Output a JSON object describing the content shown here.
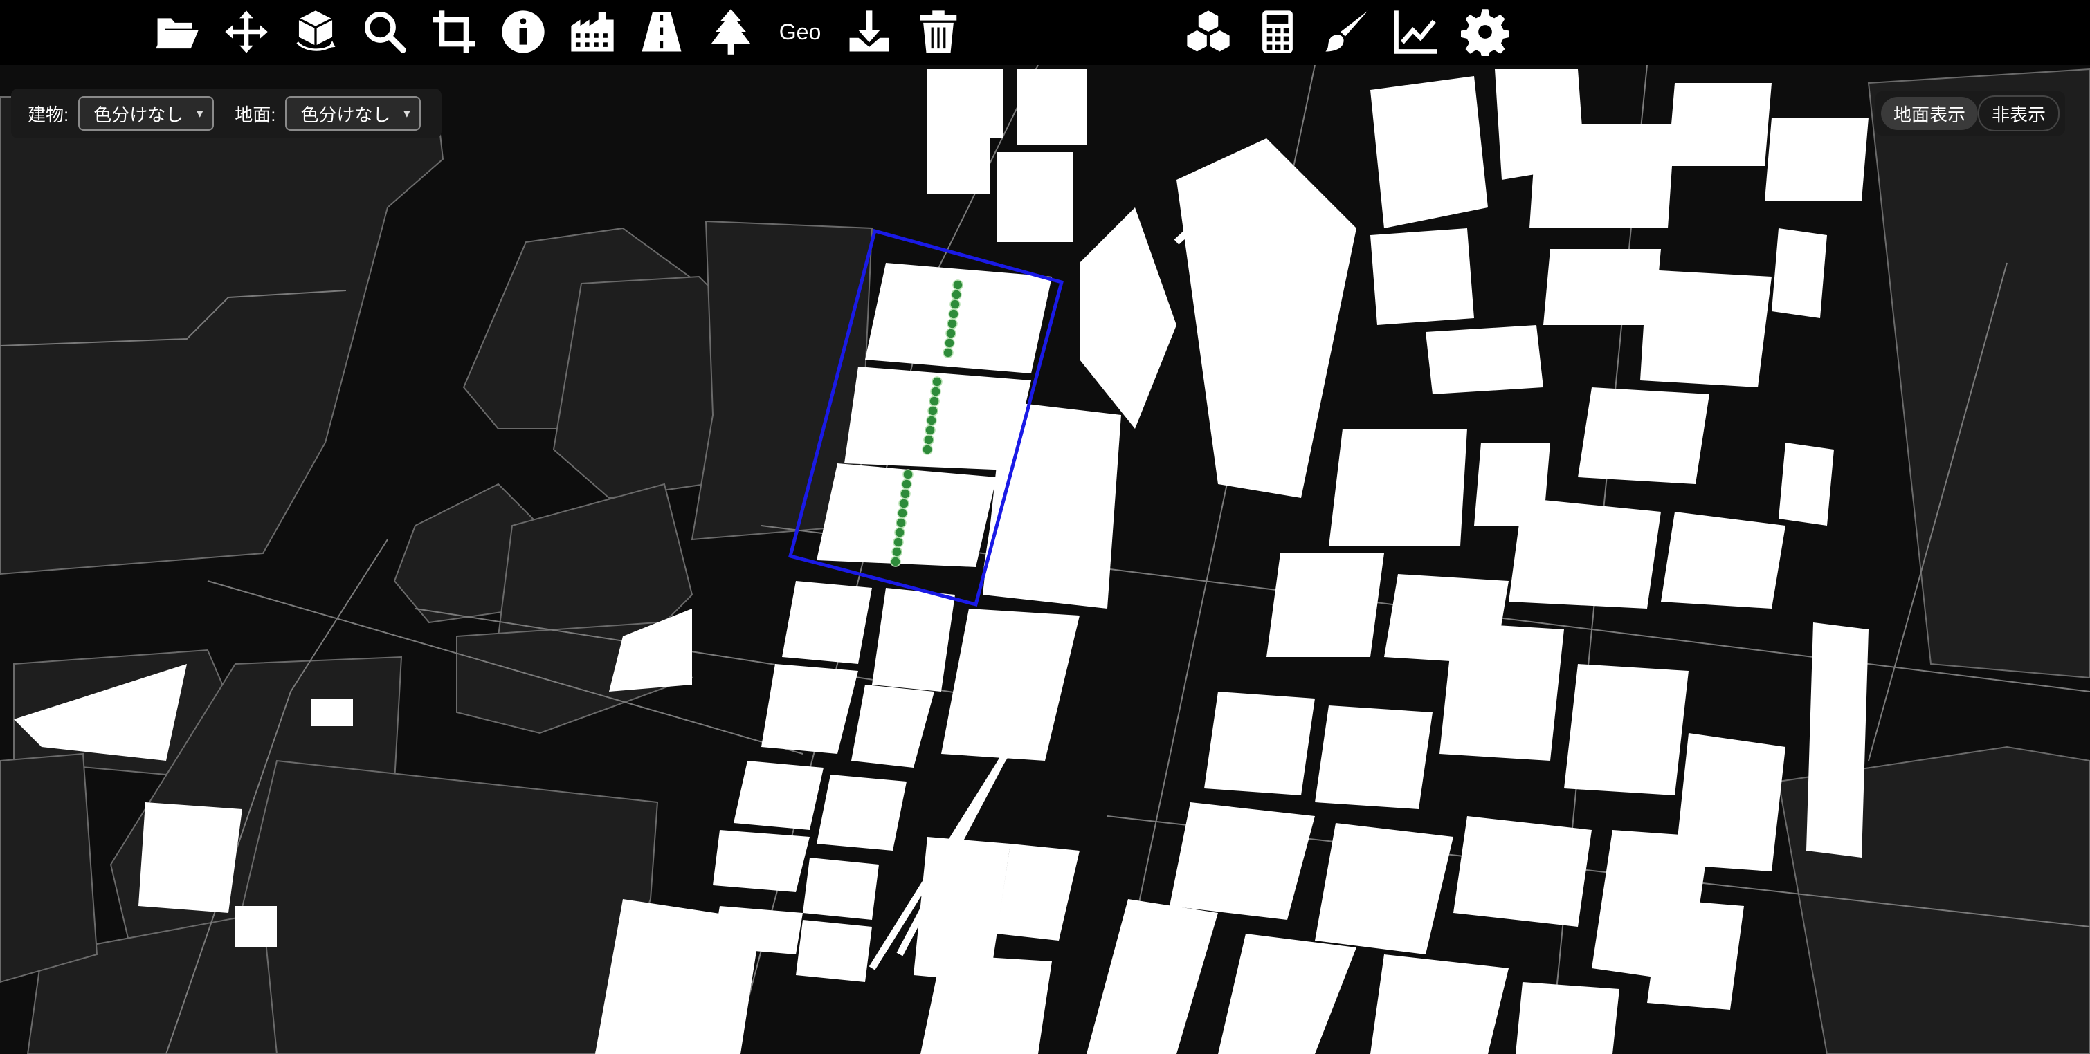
{
  "toolbar": {
    "left_tools": [
      {
        "icon": "folder-open-icon"
      },
      {
        "icon": "move-arrows-icon"
      },
      {
        "icon": "cube-rotate-icon"
      },
      {
        "icon": "search-icon"
      },
      {
        "icon": "crop-icon"
      },
      {
        "icon": "info-icon"
      },
      {
        "icon": "buildings-icon"
      },
      {
        "icon": "road-icon"
      },
      {
        "icon": "tree-icon"
      },
      {
        "label": "Geo"
      },
      {
        "icon": "download-icon"
      },
      {
        "icon": "trash-icon"
      }
    ],
    "right_tools": [
      {
        "icon": "cubes-icon"
      },
      {
        "icon": "calculator-icon"
      },
      {
        "icon": "brush-icon"
      },
      {
        "icon": "line-chart-icon"
      },
      {
        "icon": "gear-icon"
      }
    ]
  },
  "filter_panel": {
    "building_label": "建物:",
    "building_value": "色分けなし",
    "ground_label": "地面:",
    "ground_value": "色分けなし"
  },
  "ground_toggle": {
    "show_label": "地面表示",
    "hide_label": "非表示",
    "selected": "地面表示"
  },
  "colors": {
    "background": "#0d0d0d",
    "toolbar": "#000000",
    "building": "#ffffff",
    "ground_block": "#1e1e1e",
    "selection_border": "#1a1ae6",
    "tree_marker": "#2e8b3a"
  }
}
